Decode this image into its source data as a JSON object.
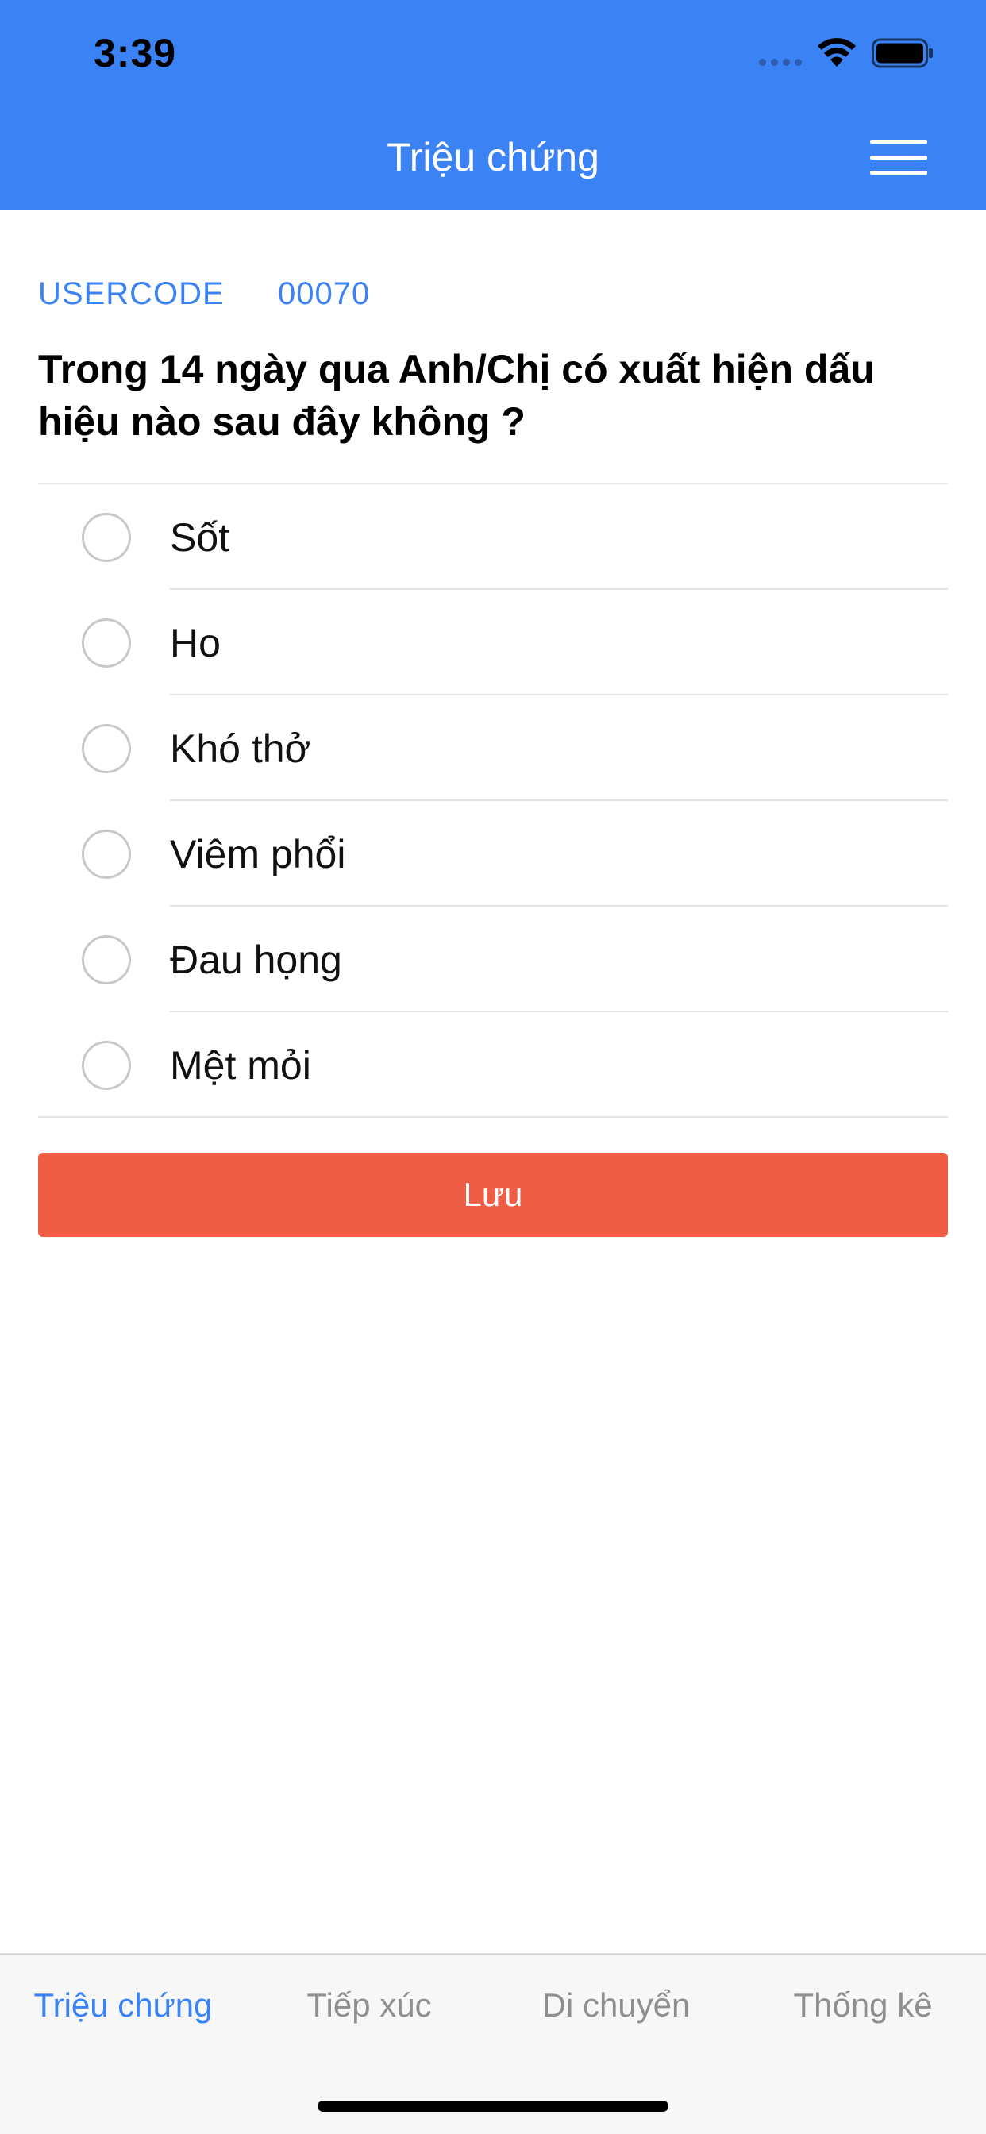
{
  "status_bar": {
    "time": "3:39",
    "icons": [
      "signal-dots-icon",
      "wifi-icon",
      "battery-icon"
    ]
  },
  "nav": {
    "title": "Triệu chứng",
    "menu_icon": "hamburger-menu-icon"
  },
  "usercode": {
    "label": "USERCODE",
    "value": "00070"
  },
  "question": "Trong 14 ngày qua Anh/Chị có xuất hiện dấu hiệu nào sau đây không ?",
  "options": [
    {
      "label": "Sốt",
      "selected": false
    },
    {
      "label": "Ho",
      "selected": false
    },
    {
      "label": "Khó thở",
      "selected": false
    },
    {
      "label": "Viêm phổi",
      "selected": false
    },
    {
      "label": "Đau họng",
      "selected": false
    },
    {
      "label": "Mệt mỏi",
      "selected": false
    }
  ],
  "save_button": {
    "label": "Lưu"
  },
  "tabs": [
    {
      "label": "Triệu chứng",
      "active": true
    },
    {
      "label": "Tiếp xúc",
      "active": false
    },
    {
      "label": "Di chuyển",
      "active": false
    },
    {
      "label": "Thống kê",
      "active": false
    }
  ],
  "colors": {
    "primary": "#3b82f5",
    "save": "#f05d45",
    "tab_inactive": "#8f8f8f",
    "divider": "#e3e3e3"
  }
}
